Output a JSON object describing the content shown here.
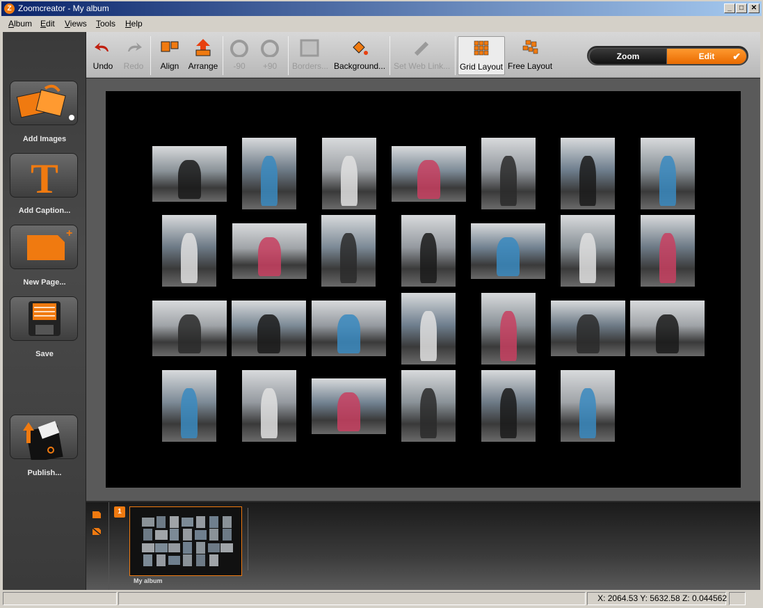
{
  "window": {
    "title": "Zoomcreator - My album",
    "app_icon_letter": "Z",
    "controls": {
      "minimize": "_",
      "maximize": "□",
      "close": "✕"
    }
  },
  "menu": [
    "Album",
    "Edit",
    "Views",
    "Tools",
    "Help"
  ],
  "sidebar": {
    "items": [
      {
        "label": "Add Images",
        "icon": "add-images-icon"
      },
      {
        "label": "Add Caption...",
        "icon": "caption-t-icon"
      },
      {
        "label": "New Page...",
        "icon": "new-page-icon"
      },
      {
        "label": "Save",
        "icon": "floppy-disk-icon"
      },
      {
        "label": "Publish...",
        "icon": "publish-icon"
      }
    ]
  },
  "toolbar": {
    "undo": "Undo",
    "redo": "Redo",
    "align": "Align",
    "arrange": "Arrange",
    "rotate_left": "-90",
    "rotate_right": "+90",
    "borders": "Borders...",
    "background": "Background...",
    "web_link": "Set Web Link...",
    "grid_layout": "Grid Layout",
    "free_layout": "Free Layout"
  },
  "mode_toggle": {
    "zoom": "Zoom",
    "edit": "Edit",
    "selected": "Edit"
  },
  "colors": {
    "accent": "#f07a10",
    "canvas": "#000000",
    "workspace": "#5a5a5a"
  },
  "pages": [
    {
      "number": "1",
      "label": "My album"
    }
  ],
  "status": {
    "coordinates": "X: 2064.53 Y: 5632.58 Z: 0.044562"
  }
}
